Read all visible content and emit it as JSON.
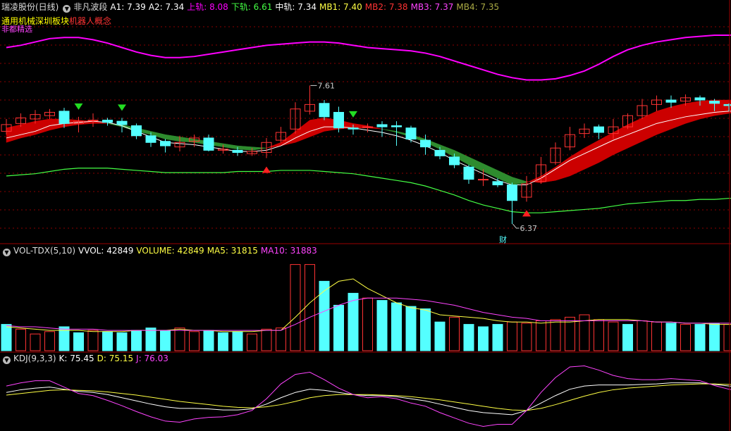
{
  "main_header": {
    "stock": "瑞凌股份(日线)",
    "indicator": "非凡波段",
    "items": [
      {
        "label": "A1: 7.39",
        "color": "#ffffff"
      },
      {
        "label": "A2: 7.34",
        "color": "#ffffff"
      },
      {
        "label": "上轨: 8.08",
        "color": "#ff00ff"
      },
      {
        "label": "下轨: 6.61",
        "color": "#44ff44"
      },
      {
        "label": "中轨: 7.34",
        "color": "#ffffff"
      },
      {
        "label": "MB1: 7.40",
        "color": "#ffff44"
      },
      {
        "label": "MB2: 7.38",
        "color": "#ff3333"
      },
      {
        "label": "MB3: 7.37",
        "color": "#ff44ff"
      },
      {
        "label": "MB4: 7.35",
        "color": "#aaaa44"
      }
    ]
  },
  "concepts": [
    {
      "label": "通用机械",
      "color": "#ffff00"
    },
    {
      "label": "深圳板块",
      "color": "#ffff00"
    },
    {
      "label": "机器人概念",
      "color": "#ff3333"
    }
  ],
  "note": {
    "label": "非都精选",
    "color": "#ff44ff"
  },
  "annotations": {
    "high": "7.61",
    "low": "6.37",
    "marker": "财"
  },
  "vol_header": {
    "indicator": "VOL-TDX(5,10)",
    "items": [
      {
        "label": "VVOL: 42849",
        "color": "#ffffff"
      },
      {
        "label": "VOLUME: 42849",
        "color": "#ffff44"
      },
      {
        "label": "MA5: 31815",
        "color": "#ffff44"
      },
      {
        "label": "MA10: 31883",
        "color": "#ff44ff"
      }
    ]
  },
  "kdj_header": {
    "indicator": "KDJ(9,3,3)",
    "items": [
      {
        "label": "K: 75.45",
        "color": "#ffffff"
      },
      {
        "label": "D: 75.15",
        "color": "#ffff44"
      },
      {
        "label": "J: 76.03",
        "color": "#ff44ff"
      }
    ]
  },
  "colors": {
    "up": "#ff3333",
    "down": "#54ffff",
    "upper_band": "#ff00ff",
    "lower_band": "#44ff44",
    "mid": "#ffffff",
    "ribbon_up": "#cc0000",
    "ribbon_down": "#2e8b2e",
    "grid": "#8b0000"
  },
  "chart_data": [
    {
      "type": "candlestick",
      "title": "瑞凌股份(日线)",
      "price_range": [
        6.2,
        8.3
      ],
      "candles": [
        [
          7.2,
          7.26,
          7.31,
          7.17
        ],
        [
          7.27,
          7.32,
          7.36,
          7.24
        ],
        [
          7.31,
          7.35,
          7.39,
          7.27
        ],
        [
          7.34,
          7.37,
          7.4,
          7.31
        ],
        [
          7.38,
          7.27,
          7.41,
          7.23
        ],
        [
          7.27,
          7.29,
          7.33,
          7.19
        ],
        [
          7.3,
          7.3,
          7.36,
          7.24
        ],
        [
          7.3,
          7.28,
          7.32,
          7.25
        ],
        [
          7.29,
          7.26,
          7.32,
          7.19
        ],
        [
          7.25,
          7.16,
          7.27,
          7.13
        ],
        [
          7.16,
          7.1,
          7.19,
          7.06
        ],
        [
          7.11,
          7.07,
          7.13,
          7.01
        ],
        [
          7.06,
          7.1,
          7.16,
          7.02
        ],
        [
          7.11,
          7.14,
          7.17,
          7.06
        ],
        [
          7.14,
          7.03,
          7.17,
          7.02
        ],
        [
          7.03,
          7.04,
          7.08,
          7.0
        ],
        [
          7.03,
          7.01,
          7.06,
          6.98
        ],
        [
          7.0,
          7.02,
          7.05,
          6.98
        ],
        [
          7.01,
          7.1,
          7.14,
          6.96
        ],
        [
          7.12,
          7.19,
          7.24,
          7.1
        ],
        [
          7.22,
          7.4,
          7.46,
          7.18
        ],
        [
          7.38,
          7.44,
          7.61,
          7.35
        ],
        [
          7.45,
          7.33,
          7.48,
          7.3
        ],
        [
          7.37,
          7.23,
          7.42,
          7.19
        ],
        [
          7.23,
          7.22,
          7.26,
          7.17
        ],
        [
          7.24,
          7.24,
          7.27,
          7.19
        ],
        [
          7.26,
          7.24,
          7.29,
          7.15
        ],
        [
          7.25,
          7.24,
          7.29,
          7.07
        ],
        [
          7.23,
          7.13,
          7.25,
          7.1
        ],
        [
          7.12,
          7.06,
          7.17,
          6.99
        ],
        [
          7.03,
          6.98,
          7.06,
          6.95
        ],
        [
          6.97,
          6.9,
          7.0,
          6.87
        ],
        [
          6.88,
          6.77,
          6.9,
          6.73
        ],
        [
          6.77,
          6.77,
          6.86,
          6.71
        ],
        [
          6.75,
          6.72,
          6.78,
          6.7
        ],
        [
          6.72,
          6.58,
          6.74,
          6.37
        ],
        [
          6.61,
          6.73,
          6.8,
          6.57
        ],
        [
          6.75,
          6.9,
          6.97,
          6.73
        ],
        [
          6.92,
          7.05,
          7.1,
          6.9
        ],
        [
          7.06,
          7.17,
          7.24,
          7.03
        ],
        [
          7.18,
          7.22,
          7.27,
          7.14
        ],
        [
          7.24,
          7.19,
          7.26,
          7.13
        ],
        [
          7.18,
          7.24,
          7.31,
          7.13
        ],
        [
          7.24,
          7.34,
          7.36,
          7.22
        ],
        [
          7.34,
          7.43,
          7.49,
          7.31
        ],
        [
          7.44,
          7.48,
          7.52,
          7.38
        ],
        [
          7.48,
          7.46,
          7.52,
          7.41
        ],
        [
          7.47,
          7.5,
          7.53,
          7.43
        ],
        [
          7.5,
          7.48,
          7.52,
          7.43
        ],
        [
          7.47,
          7.45,
          7.49,
          7.38
        ],
        [
          7.44,
          7.43,
          7.45,
          7.38
        ],
        [
          7.43,
          7.46,
          7.48,
          7.4
        ],
        [
          7.46,
          7.48,
          7.49,
          7.42
        ],
        [
          7.47,
          7.45,
          7.5,
          7.43
        ],
        [
          7.46,
          7.49,
          7.51,
          7.44
        ],
        [
          7.47,
          7.58,
          7.61,
          7.41
        ]
      ],
      "annotations": [
        {
          "text": "7.61",
          "index": 21,
          "price": 7.61
        },
        {
          "text": "6.37",
          "index": 35,
          "price": 6.37
        }
      ],
      "buy_signals": [
        18,
        36,
        54
      ],
      "sell_signals": [
        5,
        8,
        24,
        52
      ],
      "upper_band": [
        7.95,
        7.97,
        8.0,
        8.03,
        8.04,
        8.04,
        8.02,
        7.99,
        7.95,
        7.91,
        7.88,
        7.86,
        7.86,
        7.87,
        7.89,
        7.91,
        7.93,
        7.95,
        7.97,
        7.98,
        7.99,
        8.0,
        8.0,
        7.99,
        7.97,
        7.95,
        7.94,
        7.93,
        7.92,
        7.9,
        7.87,
        7.83,
        7.79,
        7.75,
        7.71,
        7.68,
        7.66,
        7.66,
        7.67,
        7.7,
        7.74,
        7.8,
        7.87,
        7.93,
        7.97,
        8.0,
        8.02,
        8.04,
        8.05,
        8.06,
        8.06,
        8.07,
        8.07,
        8.07,
        8.08,
        8.08
      ],
      "lower_band": [
        6.8,
        6.81,
        6.82,
        6.84,
        6.86,
        6.87,
        6.87,
        6.87,
        6.86,
        6.85,
        6.84,
        6.83,
        6.83,
        6.83,
        6.83,
        6.83,
        6.84,
        6.84,
        6.84,
        6.85,
        6.85,
        6.85,
        6.84,
        6.83,
        6.82,
        6.8,
        6.78,
        6.76,
        6.74,
        6.71,
        6.67,
        6.63,
        6.58,
        6.54,
        6.51,
        6.48,
        6.47,
        6.47,
        6.48,
        6.49,
        6.5,
        6.51,
        6.53,
        6.55,
        6.56,
        6.57,
        6.58,
        6.58,
        6.59,
        6.59,
        6.6,
        6.6,
        6.6,
        6.6,
        6.61,
        6.61
      ],
      "mid_line": [
        7.14,
        7.17,
        7.2,
        7.25,
        7.27,
        7.28,
        7.29,
        7.28,
        7.25,
        7.2,
        7.15,
        7.1,
        7.09,
        7.08,
        7.06,
        7.04,
        7.02,
        7.02,
        7.03,
        7.07,
        7.14,
        7.2,
        7.24,
        7.24,
        7.23,
        7.21,
        7.19,
        7.16,
        7.12,
        7.07,
        7.01,
        6.94,
        6.88,
        6.82,
        6.76,
        6.72,
        6.72,
        6.78,
        6.86,
        6.94,
        7.0,
        7.06,
        7.12,
        7.17,
        7.22,
        7.27,
        7.3,
        7.33,
        7.35,
        7.37,
        7.38,
        7.38,
        7.38,
        7.38,
        7.38,
        7.39
      ],
      "ribbon_a": [
        7.23,
        7.26,
        7.29,
        7.31,
        7.31,
        7.3,
        7.29,
        7.27,
        7.24,
        7.2,
        7.17,
        7.13,
        7.11,
        7.1,
        7.08,
        7.06,
        7.04,
        7.03,
        7.05,
        7.1,
        7.2,
        7.3,
        7.32,
        7.3,
        7.27,
        7.25,
        7.22,
        7.19,
        7.15,
        7.1,
        7.04,
        6.97,
        6.9,
        6.84,
        6.78,
        6.72,
        6.74,
        6.8,
        6.88,
        6.97,
        7.05,
        7.12,
        7.19,
        7.26,
        7.32,
        7.38,
        7.42,
        7.45,
        7.47,
        7.48,
        7.48,
        7.48,
        7.47,
        7.47,
        7.47,
        7.5
      ],
      "ribbon_b": [
        7.1,
        7.14,
        7.17,
        7.21,
        7.24,
        7.26,
        7.27,
        7.27,
        7.26,
        7.23,
        7.2,
        7.17,
        7.15,
        7.13,
        7.11,
        7.09,
        7.07,
        7.06,
        7.05,
        7.07,
        7.1,
        7.15,
        7.2,
        7.22,
        7.23,
        7.23,
        7.22,
        7.2,
        7.17,
        7.13,
        7.08,
        7.03,
        6.97,
        6.91,
        6.85,
        6.79,
        6.75,
        6.74,
        6.76,
        6.8,
        6.86,
        6.92,
        6.99,
        7.05,
        7.11,
        7.17,
        7.22,
        7.27,
        7.31,
        7.34,
        7.36,
        7.38,
        7.39,
        7.4,
        7.4,
        7.42
      ]
    },
    {
      "type": "bar",
      "title": "VOL-TDX(5,10)",
      "values": [
        22,
        18,
        14,
        16,
        20,
        15,
        17,
        16,
        15,
        17,
        19,
        17,
        19,
        16,
        17,
        15,
        16,
        14,
        18,
        19,
        72,
        72,
        58,
        38,
        48,
        44,
        42,
        40,
        37,
        35,
        24,
        28,
        22,
        20,
        22,
        24,
        23,
        25,
        26,
        28,
        30,
        26,
        24,
        22,
        25,
        24,
        23,
        22,
        22,
        23,
        22,
        20,
        21,
        19,
        20,
        32
      ],
      "up_down": [
        0,
        1,
        1,
        1,
        0,
        0,
        1,
        0,
        0,
        0,
        0,
        0,
        1,
        1,
        0,
        0,
        0,
        1,
        1,
        1,
        1,
        1,
        0,
        0,
        0,
        1,
        0,
        0,
        0,
        0,
        0,
        1,
        0,
        0,
        0,
        1,
        1,
        1,
        1,
        1,
        1,
        1,
        1,
        0,
        1,
        1,
        0,
        1,
        0,
        0,
        1,
        1,
        0,
        0,
        0,
        1
      ],
      "ma5": [
        20,
        19,
        18,
        17,
        17,
        17,
        16,
        16,
        16,
        17,
        17,
        17,
        18,
        17,
        17,
        16,
        16,
        16,
        17,
        17,
        28,
        40,
        50,
        58,
        60,
        52,
        46,
        40,
        36,
        34,
        30,
        29,
        28,
        27,
        25,
        24,
        24,
        23,
        24,
        24,
        25,
        26,
        26,
        26,
        25,
        24,
        24,
        23,
        23,
        22,
        22,
        22,
        21,
        21,
        21,
        22
      ],
      "ma10": [
        21,
        20,
        20,
        19,
        18,
        18,
        18,
        17,
        17,
        17,
        17,
        17,
        17,
        17,
        17,
        17,
        17,
        17,
        17,
        17,
        22,
        28,
        33,
        38,
        42,
        44,
        44,
        44,
        43,
        42,
        40,
        38,
        35,
        32,
        30,
        28,
        27,
        25,
        25,
        25,
        25,
        25,
        25,
        25,
        25,
        24,
        24,
        23,
        23,
        23,
        23,
        22,
        22,
        22,
        22,
        22
      ],
      "ylim": [
        0,
        80
      ]
    },
    {
      "type": "line",
      "title": "KDJ(9,3,3)",
      "series": [
        {
          "name": "K",
          "values": [
            60,
            65,
            68,
            70,
            66,
            62,
            60,
            56,
            50,
            44,
            38,
            33,
            30,
            30,
            29,
            27,
            27,
            29,
            38,
            50,
            60,
            66,
            64,
            60,
            56,
            54,
            54,
            52,
            48,
            44,
            38,
            32,
            26,
            22,
            20,
            18,
            26,
            40,
            54,
            66,
            72,
            74,
            74,
            74,
            75,
            76,
            78,
            78,
            78,
            75,
            72,
            70,
            70,
            70,
            72,
            75
          ]
        },
        {
          "name": "D",
          "values": [
            55,
            58,
            61,
            64,
            65,
            64,
            63,
            61,
            58,
            55,
            51,
            47,
            43,
            40,
            37,
            34,
            32,
            31,
            33,
            37,
            43,
            50,
            54,
            56,
            56,
            56,
            55,
            54,
            52,
            49,
            46,
            42,
            38,
            34,
            30,
            27,
            26,
            30,
            37,
            45,
            53,
            60,
            65,
            68,
            70,
            72,
            74,
            75,
            76,
            76,
            75,
            74,
            73,
            72,
            73,
            75
          ]
        },
        {
          "name": "J",
          "values": [
            72,
            78,
            82,
            82,
            70,
            58,
            54,
            45,
            35,
            24,
            14,
            6,
            4,
            10,
            13,
            14,
            18,
            26,
            48,
            76,
            94,
            98,
            84,
            68,
            56,
            50,
            52,
            48,
            40,
            34,
            22,
            12,
            2,
            -4,
            0,
            0,
            26,
            60,
            88,
            108,
            110,
            102,
            92,
            86,
            84,
            84,
            86,
            84,
            82,
            73,
            66,
            62,
            64,
            66,
            70,
            76
          ]
        }
      ]
    }
  ]
}
